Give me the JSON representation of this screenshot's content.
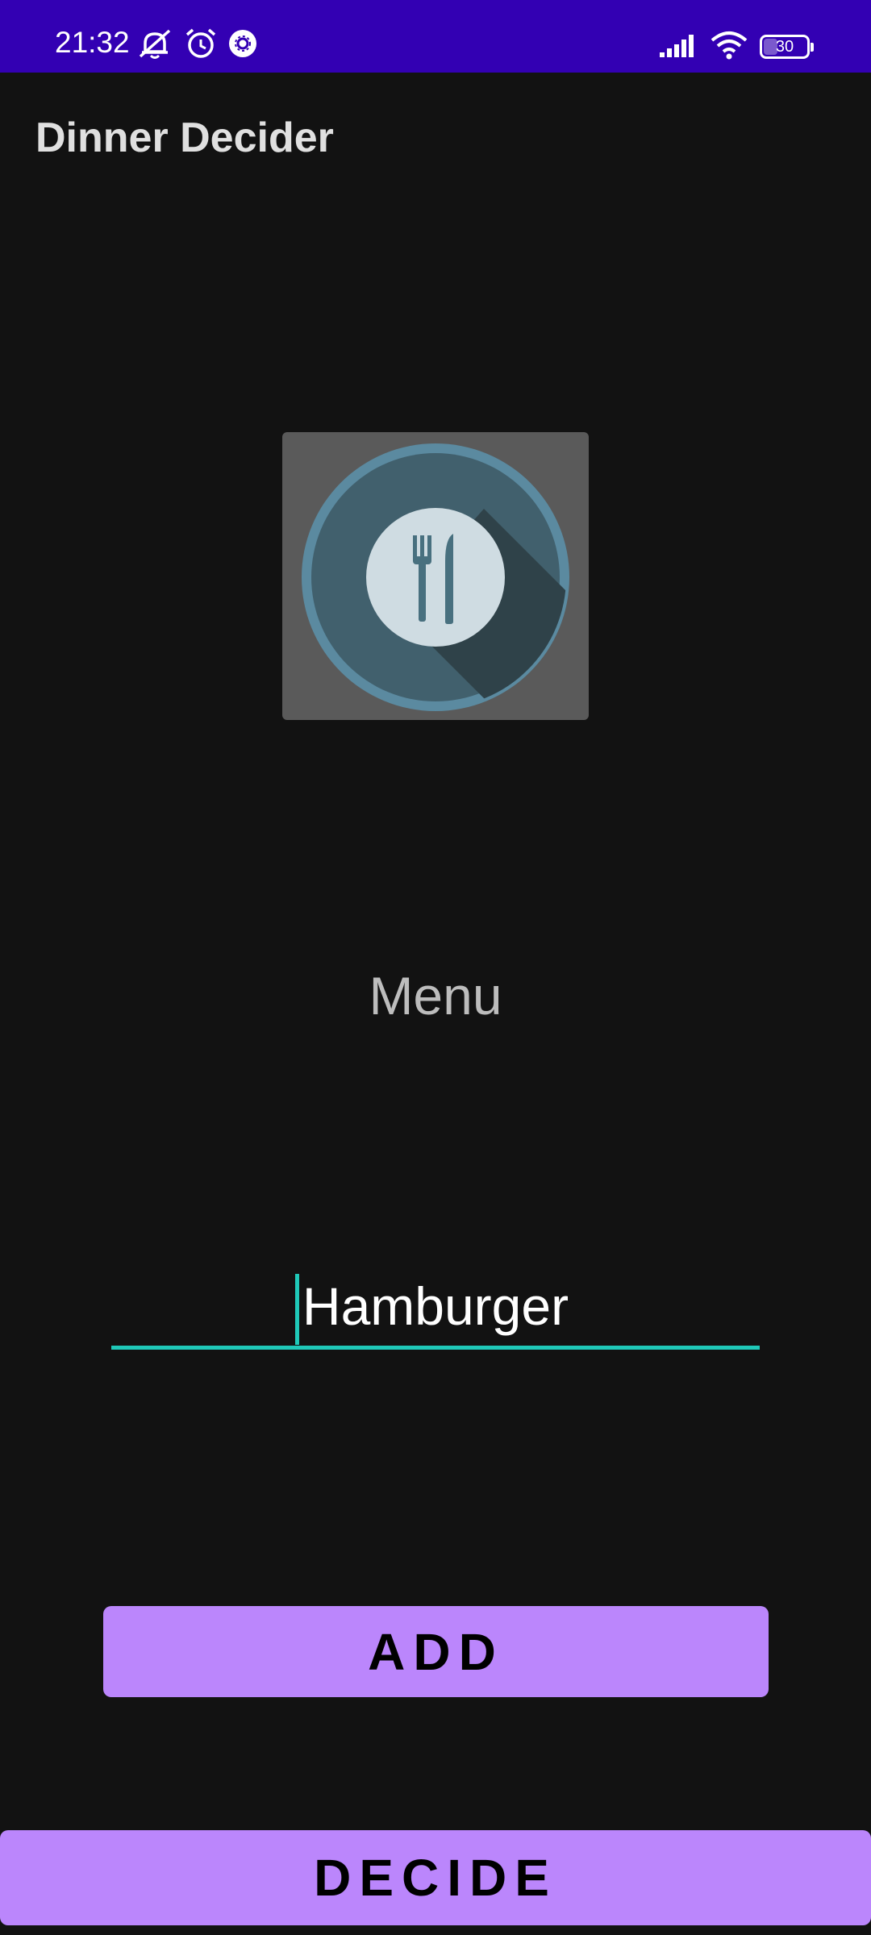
{
  "status_bar": {
    "time": "21:32",
    "battery_level": "30",
    "background_color": "#3300b3",
    "left_icons": [
      "bell-off-icon",
      "alarm-icon",
      "settings-badge-icon"
    ],
    "right_icons": [
      "signal-icon",
      "wifi-icon",
      "battery-icon"
    ]
  },
  "app_bar": {
    "title": "Dinner Decider"
  },
  "image": {
    "icon": "plate-fork-knife-icon"
  },
  "menu": {
    "label": "Menu",
    "input_value": "Hamburger"
  },
  "buttons": {
    "add_label": "ADD",
    "decide_label": "DECIDE",
    "color": "#bb86fc"
  },
  "colors": {
    "background": "#121212",
    "accent": "#1fc8b8"
  }
}
